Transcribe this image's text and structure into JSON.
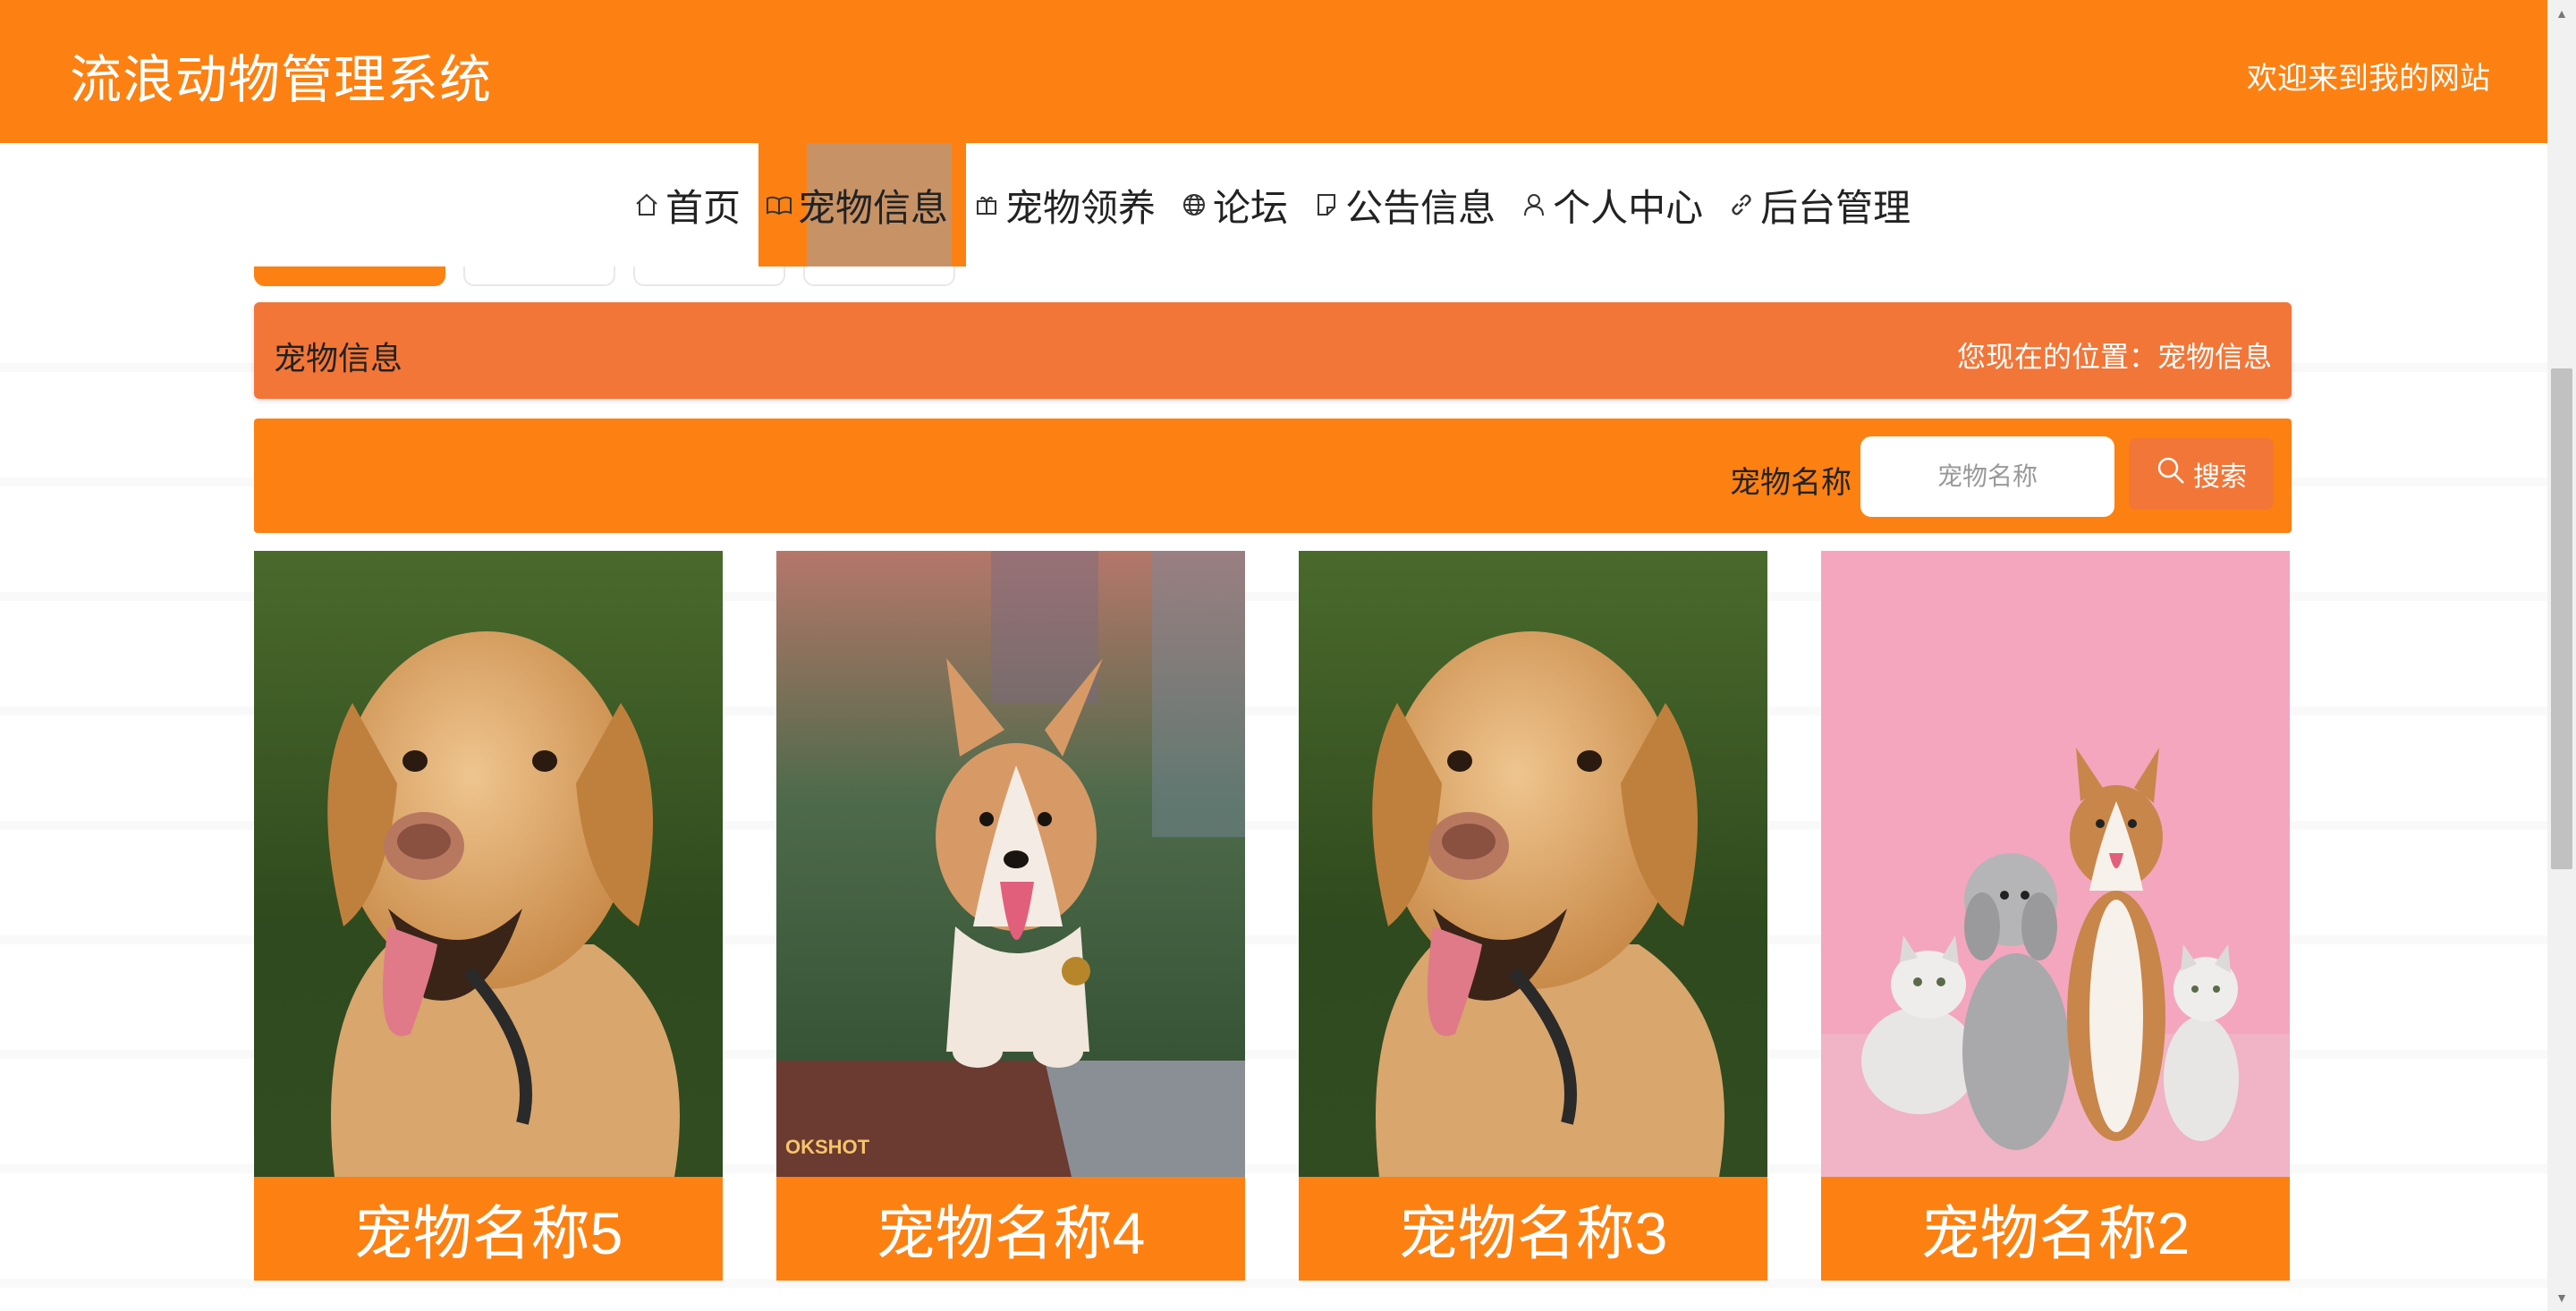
{
  "header": {
    "site_title": "流浪动物管理系统",
    "welcome": "欢迎来到我的网站"
  },
  "nav": {
    "items": [
      {
        "label": "首页",
        "icon": "home-icon"
      },
      {
        "label": "宠物信息",
        "icon": "book-icon",
        "active": true
      },
      {
        "label": "宠物领养",
        "icon": "gift-icon"
      },
      {
        "label": "论坛",
        "icon": "globe-icon"
      },
      {
        "label": "公告信息",
        "icon": "document-icon"
      },
      {
        "label": "个人中心",
        "icon": "user-icon"
      },
      {
        "label": "后台管理",
        "icon": "link-icon"
      }
    ]
  },
  "breadcrumb": {
    "title": "宠物信息",
    "location": "您现在的位置：宠物信息"
  },
  "search": {
    "label": "宠物名称",
    "placeholder": "宠物名称",
    "button_label": "搜索"
  },
  "cards": [
    {
      "name": "宠物名称5",
      "image": "golden-retriever-photo"
    },
    {
      "name": "宠物名称4",
      "image": "corgi-photo"
    },
    {
      "name": "宠物名称3",
      "image": "golden-retriever-photo"
    },
    {
      "name": "宠物名称2",
      "image": "cats-and-dogs-photo"
    }
  ],
  "watermark_text": "OKSHOT",
  "colors": {
    "primary": "#fc8112",
    "secondary": "#f27638",
    "active_highlight": "#c79266"
  }
}
